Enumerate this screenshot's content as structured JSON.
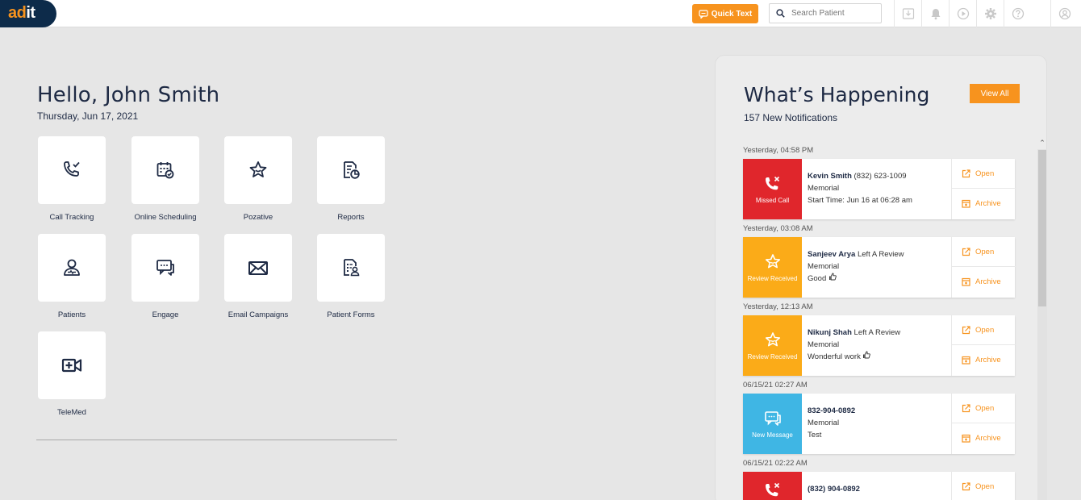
{
  "header": {
    "logo_text_a": "ad",
    "logo_text_b": "it",
    "quick_text": "Quick Text",
    "search_placeholder": "Search Patient",
    "icons": [
      "download-icon",
      "bell-icon",
      "play-icon",
      "gear-icon",
      "help-icon",
      "user-icon"
    ]
  },
  "greeting": {
    "title": "Hello, John Smith",
    "date": "Thursday, Jun 17, 2021"
  },
  "tiles": [
    {
      "label": "Call Tracking",
      "icon": "call-tracking-icon"
    },
    {
      "label": "Online Scheduling",
      "icon": "calendar-check-icon"
    },
    {
      "label": "Pozative",
      "icon": "star-icon"
    },
    {
      "label": "Reports",
      "icon": "report-icon"
    },
    {
      "label": "Patients",
      "icon": "patient-icon"
    },
    {
      "label": "Engage",
      "icon": "chat-icon"
    },
    {
      "label": "Email Campaigns",
      "icon": "envelope-icon"
    },
    {
      "label": "Patient Forms",
      "icon": "form-icon"
    },
    {
      "label": "TeleMed",
      "icon": "video-icon"
    }
  ],
  "panel": {
    "title": "What’s Happening",
    "count": "157 New Notifications",
    "view_all": "View All",
    "open_label": "Open",
    "archive_label": "Archive",
    "notifications": [
      {
        "time": "Yesterday, 04:58 PM",
        "badge": "Missed Call",
        "name": "Kevin Smith",
        "extra": " (832) 623-1009",
        "line2": "Memorial",
        "line3": "Start Time: Jun 16 at 06:28 am"
      },
      {
        "time": "Yesterday, 03:08 AM",
        "badge": "Review Received",
        "name": "Sanjeev Arya",
        "extra": " Left A Review",
        "line2": "Memorial",
        "line3": "Good"
      },
      {
        "time": "Yesterday, 12:13 AM",
        "badge": "Review Received",
        "name": "Nikunj Shah",
        "extra": " Left A Review",
        "line2": "Memorial",
        "line3": "Wonderful work"
      },
      {
        "time": "06/15/21 02:27 AM",
        "badge": "New Message",
        "name": "832-904-0892",
        "extra": "",
        "line2": "Memorial",
        "line3": "Test"
      },
      {
        "time": "06/15/21 02:22 AM",
        "badge": "",
        "name": "(832) 904-0892",
        "extra": "",
        "line2": "",
        "line3": ""
      }
    ]
  },
  "colors": {
    "accent": "#f7931e",
    "navy": "#0d2b4a",
    "missed": "#e0262c",
    "review": "#fbab18",
    "message": "#3fb6e4"
  }
}
